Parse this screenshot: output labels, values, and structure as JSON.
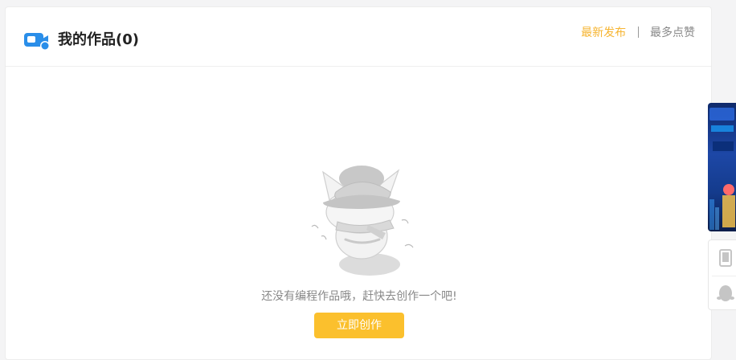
{
  "header": {
    "title": "我的作品(0)",
    "title_icon": "video-chat-icon"
  },
  "sort": {
    "tabs": [
      {
        "label": "最新发布",
        "active": true
      },
      {
        "label": "最多点赞",
        "active": false
      }
    ]
  },
  "empty_state": {
    "illustration": "sleeping-cat-illustration",
    "message": "还没有编程作品哦，赶快去创作一个吧!",
    "button_label": "立即创作"
  },
  "side": {
    "banner_icon": "promo-banner-image",
    "tools": [
      {
        "icon": "tablet-icon"
      },
      {
        "icon": "qq-penguin-icon"
      }
    ]
  },
  "colors": {
    "accent": "#fbc02d",
    "active_tab": "#f6b533",
    "brand_blue": "#2a8ee9"
  }
}
